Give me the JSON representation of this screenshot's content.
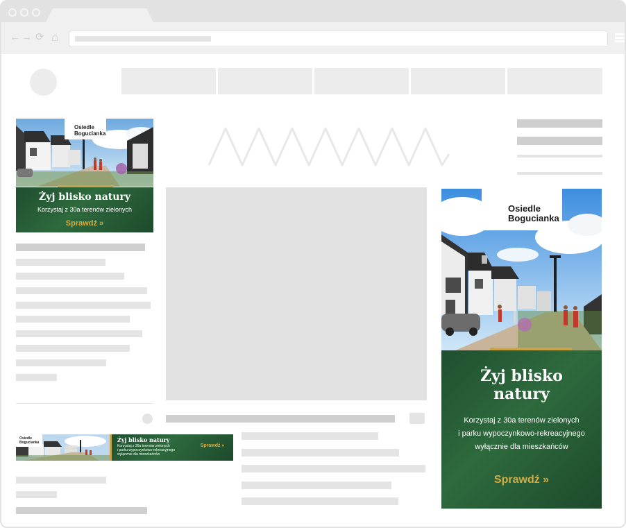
{
  "browser": {
    "nav_icons": {
      "back": "←",
      "forward": "→",
      "reload": "⟳",
      "home": "⌂"
    }
  },
  "ads": {
    "brand_line1": "Osiedle",
    "brand_line2": "Bogucianka",
    "headline": "Żyj blisko natury",
    "headline_line1": "Żyj blisko",
    "headline_line2": "natury",
    "sub_short": "Korzystaj z 30a terenów zielonych",
    "sub_long_line1": "Korzystaj z 30a terenów zielonych",
    "sub_long_line2": "i parku wypoczynkowo-rekreacyjnego",
    "sub_long_line3": "wyłącznie dla mieszkańców",
    "leader_line1": "Korzystaj z 30a terenów zielonych",
    "leader_line2": "i parku wypoczynkowo-rekreacyjnego",
    "leader_line3": "wyłącznie dla mieszkańców",
    "cta": "Sprawdź »"
  },
  "colors": {
    "ad_green": "#2e6a3d",
    "ad_gold": "#c9a347",
    "placeholder_light": "#ececec",
    "placeholder_mid": "#e2e2e2",
    "placeholder_dark": "#cfcfcf"
  }
}
